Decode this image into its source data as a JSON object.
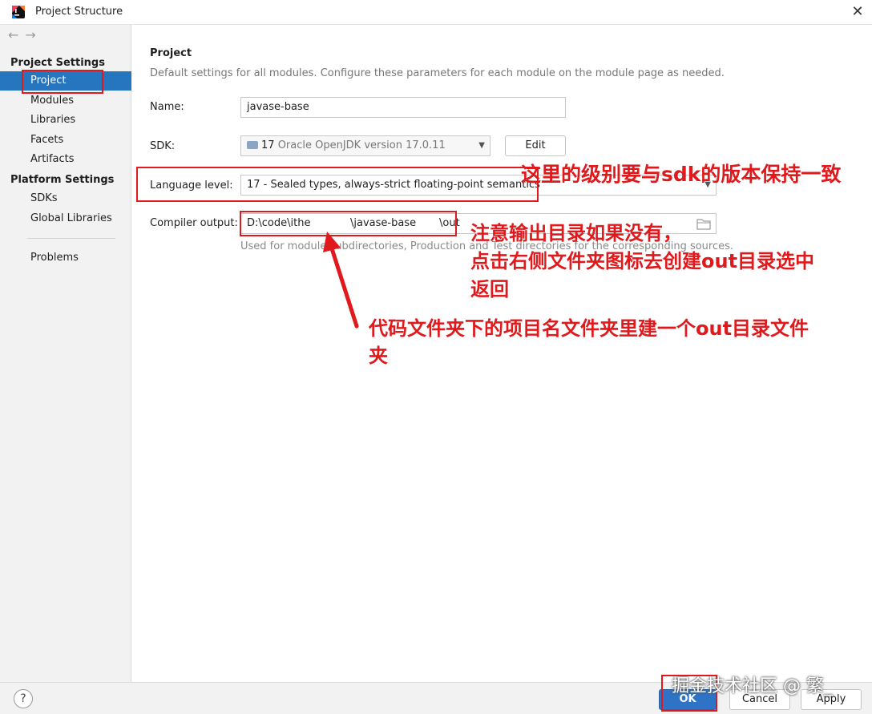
{
  "window": {
    "title": "Project Structure"
  },
  "sidebar": {
    "nav_back": "←",
    "nav_forward": "→",
    "project_settings_heading": "Project Settings",
    "project_items": [
      {
        "label": "Project"
      },
      {
        "label": "Modules"
      },
      {
        "label": "Libraries"
      },
      {
        "label": "Facets"
      },
      {
        "label": "Artifacts"
      }
    ],
    "platform_settings_heading": "Platform Settings",
    "platform_items": [
      {
        "label": "SDKs"
      },
      {
        "label": "Global Libraries"
      }
    ],
    "problems_label": "Problems"
  },
  "main": {
    "title": "Project",
    "description": "Default settings for all modules. Configure these parameters for each module on the module page as needed.",
    "name_label": "Name:",
    "name_value": "javase-base",
    "sdk_label": "SDK:",
    "sdk_version": "17",
    "sdk_name": "Oracle OpenJDK version 17.0.11",
    "edit_label": "Edit",
    "language_level_label": "Language level:",
    "language_level_value": "17 - Sealed types, always-strict floating-point semantics",
    "compiler_output_label": "Compiler output:",
    "compiler_output_value": "D:\\code\\ithe            \\javase-base       \\out",
    "compiler_hint": "Used for module subdirectories, Production and Test directories for the corresponding sources."
  },
  "footer": {
    "help_label": "?",
    "ok_label": "OK",
    "cancel_label": "Cancel",
    "apply_label": "Apply"
  },
  "annotations": {
    "note_language": "这里的级别要与sdk的版本保持一致",
    "note_output_line1": "注意输出目录如果没有，",
    "note_output_line2": "点击右侧文件夹图标去创建out目录选中",
    "note_output_line3": "返回",
    "note_folder_line1": "代码文件夹下的项目名文件夹里建一个out目录文件",
    "note_folder_line2": "夹"
  },
  "watermark": "掘金技术社区 @ 繁_",
  "colors": {
    "selection": "#2675bf",
    "annotation_red": "#e0191c",
    "primary_button": "#2e73c6"
  }
}
